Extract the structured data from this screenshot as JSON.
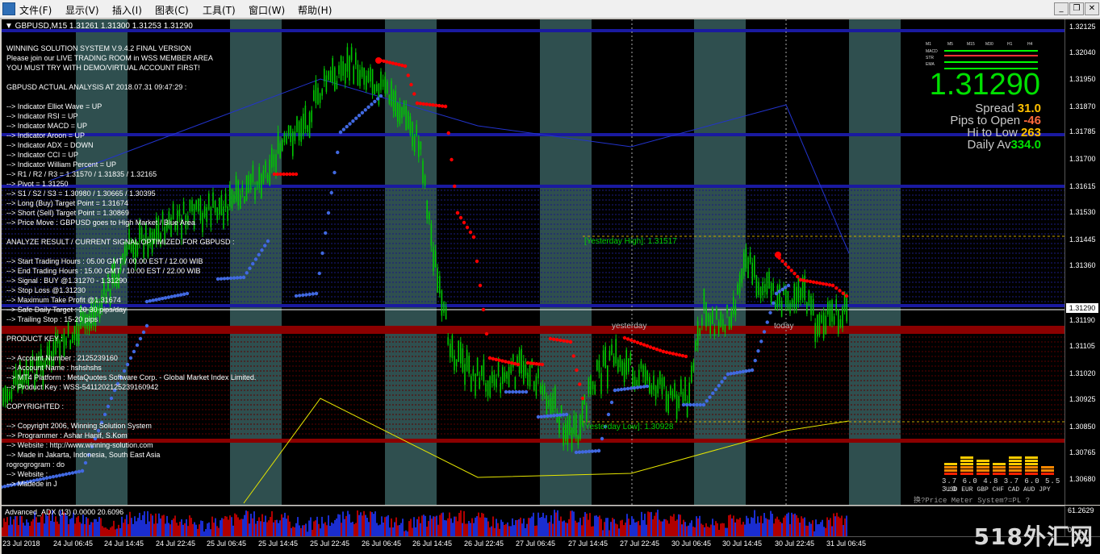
{
  "menu": {
    "items": [
      "文件(F)",
      "显示(V)",
      "插入(I)",
      "图表(C)",
      "工具(T)",
      "窗口(W)",
      "帮助(H)"
    ]
  },
  "window_controls": {
    "minimize": "_",
    "restore": "❐",
    "close": "✕"
  },
  "chart": {
    "header": "▼ GBPUSD,M15  1.31261 1.31300 1.31253 1.31290",
    "symbol": "GBPUSD",
    "timeframe": "M15",
    "ohlc": [
      1.31261,
      1.313,
      1.31253,
      1.3129
    ],
    "current_price": "1.31290",
    "yaxis_ticks": [
      "1.32125",
      "1.32040",
      "1.31950",
      "1.31870",
      "1.31785",
      "1.31700",
      "1.31615",
      "1.31530",
      "1.31445",
      "1.31360",
      "1.31290",
      "1.31190",
      "1.31105",
      "1.31020",
      "1.30925",
      "1.30850",
      "1.30765",
      "1.30680"
    ],
    "time_ticks": [
      "23 Jul 2018",
      "24 Jul 06:45",
      "24 Jul 14:45",
      "24 Jul 22:45",
      "25 Jul 06:45",
      "25 Jul 14:45",
      "25 Jul 22:45",
      "26 Jul 06:45",
      "26 Jul 14:45",
      "26 Jul 22:45",
      "27 Jul 06:45",
      "27 Jul 14:45",
      "27 Jul 22:45",
      "30 Jul 06:45",
      "30 Jul 14:45",
      "30 Jul 22:45",
      "31 Jul 06:45"
    ],
    "yesterday_high": "[Yesterday High]: 1.31517",
    "yesterday_low": "[Yesterday Low]: 1.30928",
    "label_yesterday": "yesterday",
    "label_today": "today",
    "colors": {
      "bull_candle": "#00c800",
      "signal_up": "#4169e1",
      "signal_down": "#ff0000",
      "level_line": "#1a1aa0",
      "support_band": "#8b0000",
      "background": "#000000"
    }
  },
  "info_panel": {
    "lines": [
      "WINNING SOLUTION SYSTEM V.9.4.2 FINAL VERSION",
      "Please join our LIVE TRADING ROOM in WSS MEMBER AREA",
      "YOU MUST TRY WITH DEMO/VIRTUAL ACCOUNT FIRST!",
      "",
      "  GBPUSD ACTUAL ANALYSIS AT 2018.07.31 09:47:29 :",
      "",
      "  --> Indicator Elliot Wave = UP",
      "  --> Indicator RSI = UP",
      "  --> Indicator MACD = UP",
      "  --> Indicator Aroon = UP",
      "  --> Indicator ADX = DOWN",
      "  --> Indicator CCI = UP",
      "  --> Indicator William Percent = UP",
      "  --> R1 / R2 / R3 = 1.31570 / 1.31835 / 1.32165",
      "  --> Pivot = 1.31250",
      "  --> S1 / S2 / S3 = 1.30980 / 1.30665 / 1.30395",
      "  --> Long (Buy) Target Point = 1.31674",
      "  --> Short (Sell) Target Point = 1.30869",
      "  --> Price Move : GBPUSD goes to High Market / Blue Area",
      "",
      "  ANALYZE RESULT / CURRENT SIGNAL OPTIMIZED FOR GBPUSD :",
      "",
      "  --> Start Trading Hours : 05.00 GMT / 00.00 EST / 12.00 WIB",
      "  --> End Trading Hours : 15.00 GMT / 10.00 EST / 22.00 WIB",
      "  --> Signal : BUY @1.31270 - 1.31290",
      "  --> Stop Loss @1.31230",
      "  --> Maximum Take Profit @1.31674",
      "  --> Safe Daily Target : 20-30 pips/day",
      "  --> Trailing Stop : 15-20 pips",
      "",
      "  PRODUCT KEY :",
      "",
      "  --> Account Number : 2125239160",
      "  --> Account Name : hshshshs",
      "  --> MT4 Platform : MetaQuotes Software Corp. - Global Market Index Limited.",
      "  --> Product Key : WSS-5411202125239160942",
      "",
      "  COPYRIGHTED :",
      "",
      "  --> Copyright 2006, Winning Solution System",
      "  --> Programmer : Ashar Hanif, S.Kom",
      "  --> Website : http://www.winning-solution.com",
      "  --> Made in Jakarta, Indonesia, South East Asia",
      "  rogrogrogram : do",
      "  --> Website :",
      "  --> Madede in J"
    ]
  },
  "stats": {
    "spread_label": "Spread",
    "spread_value": "31.0",
    "pips_label": "Pips to Open",
    "pips_value": "-46",
    "hilo_label": "Hi to Low",
    "hilo_value": "263",
    "daily_label": "Daily Av",
    "daily_value": "334.0"
  },
  "mini_table": {
    "timeframes": [
      "M1",
      "M5",
      "M15",
      "M30",
      "H1",
      "H4"
    ],
    "rows": [
      "MACD",
      "STR",
      "EMA"
    ]
  },
  "price_meter": {
    "values": "3.7 6.0 4.8 3.7 6.0 5.5 3.0",
    "currencies": "USD EUR GBP CHF CAD AUD JPY",
    "title": "换?Price Meter System?=PL    ?"
  },
  "adx": {
    "label": "Advanced_ADX (13) 0.0000 20.6096",
    "axis": [
      "61.2629",
      "0"
    ]
  },
  "watermark": "518外汇网"
}
